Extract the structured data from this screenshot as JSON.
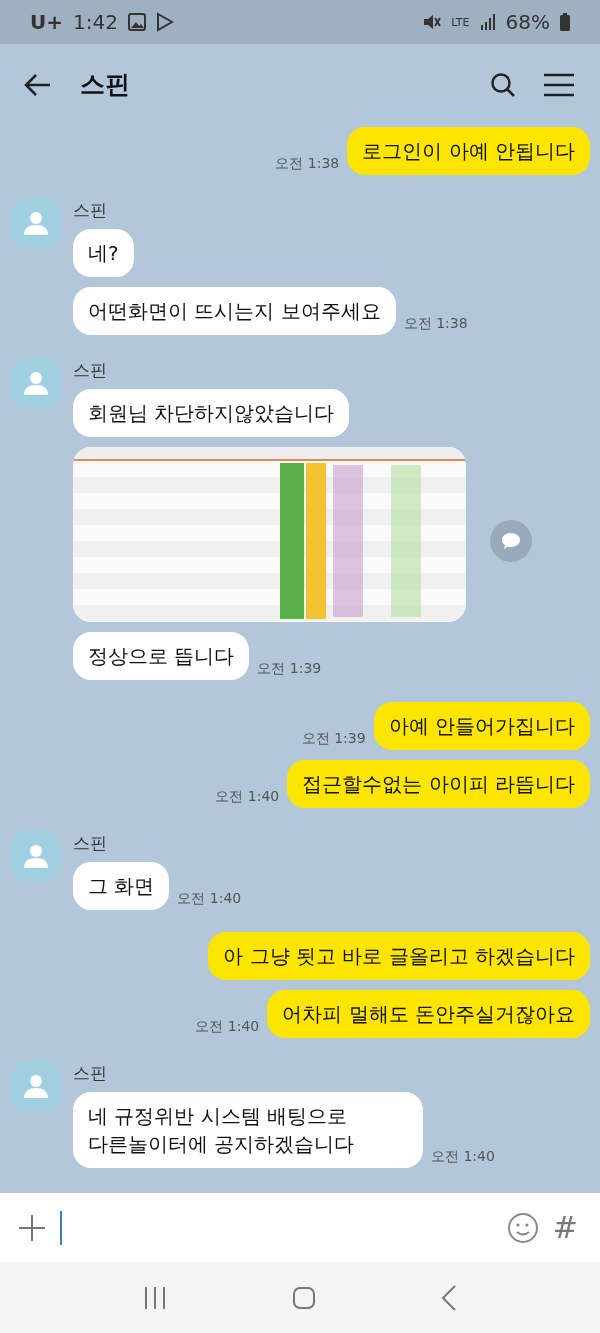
{
  "status_bar": {
    "carrier": "U+",
    "time": "1:42",
    "network": "LTE",
    "battery": "68%"
  },
  "header": {
    "title": "스핀"
  },
  "messages": [
    {
      "outgoing": true,
      "kind": "text",
      "text": "로그인이 아예 안됩니다",
      "time": "오전 1:38"
    },
    {
      "outgoing": false,
      "kind": "text",
      "sender": "스핀",
      "text": "네?"
    },
    {
      "outgoing": false,
      "kind": "text",
      "text": "어떤화면이 뜨시는지 보여주세요",
      "time": "오전 1:38"
    },
    {
      "outgoing": false,
      "kind": "text",
      "sender": "스핀",
      "text": "회원님 차단하지않았습니다"
    },
    {
      "kind": "picture"
    },
    {
      "outgoing": false,
      "kind": "text",
      "text": "정상으로 뜹니다",
      "time": "오전 1:39"
    },
    {
      "outgoing": true,
      "kind": "text",
      "text": "아예 안들어가집니다",
      "time": "오전 1:39"
    },
    {
      "outgoing": true,
      "kind": "text",
      "text": "접근할수없는 아이피 라뜹니다",
      "time": "오전 1:40"
    },
    {
      "outgoing": false,
      "kind": "text",
      "sender": "스핀",
      "text": "그 화면",
      "time": "오전 1:40"
    },
    {
      "outgoing": true,
      "kind": "text",
      "text": "아 그냥 됫고 바로 글올리고 하겠습니다"
    },
    {
      "outgoing": true,
      "kind": "text",
      "text": "어차피 멀해도 돈안주실거잖아요",
      "time": "오전 1:40"
    },
    {
      "outgoing": false,
      "kind": "text",
      "sender": "스핀",
      "text": "네 규정위반 시스템 배팅으로 다른놀이터에 공지하겠습니다",
      "time": "오전 1:40"
    }
  ],
  "composer": {
    "hashtag": "#"
  }
}
